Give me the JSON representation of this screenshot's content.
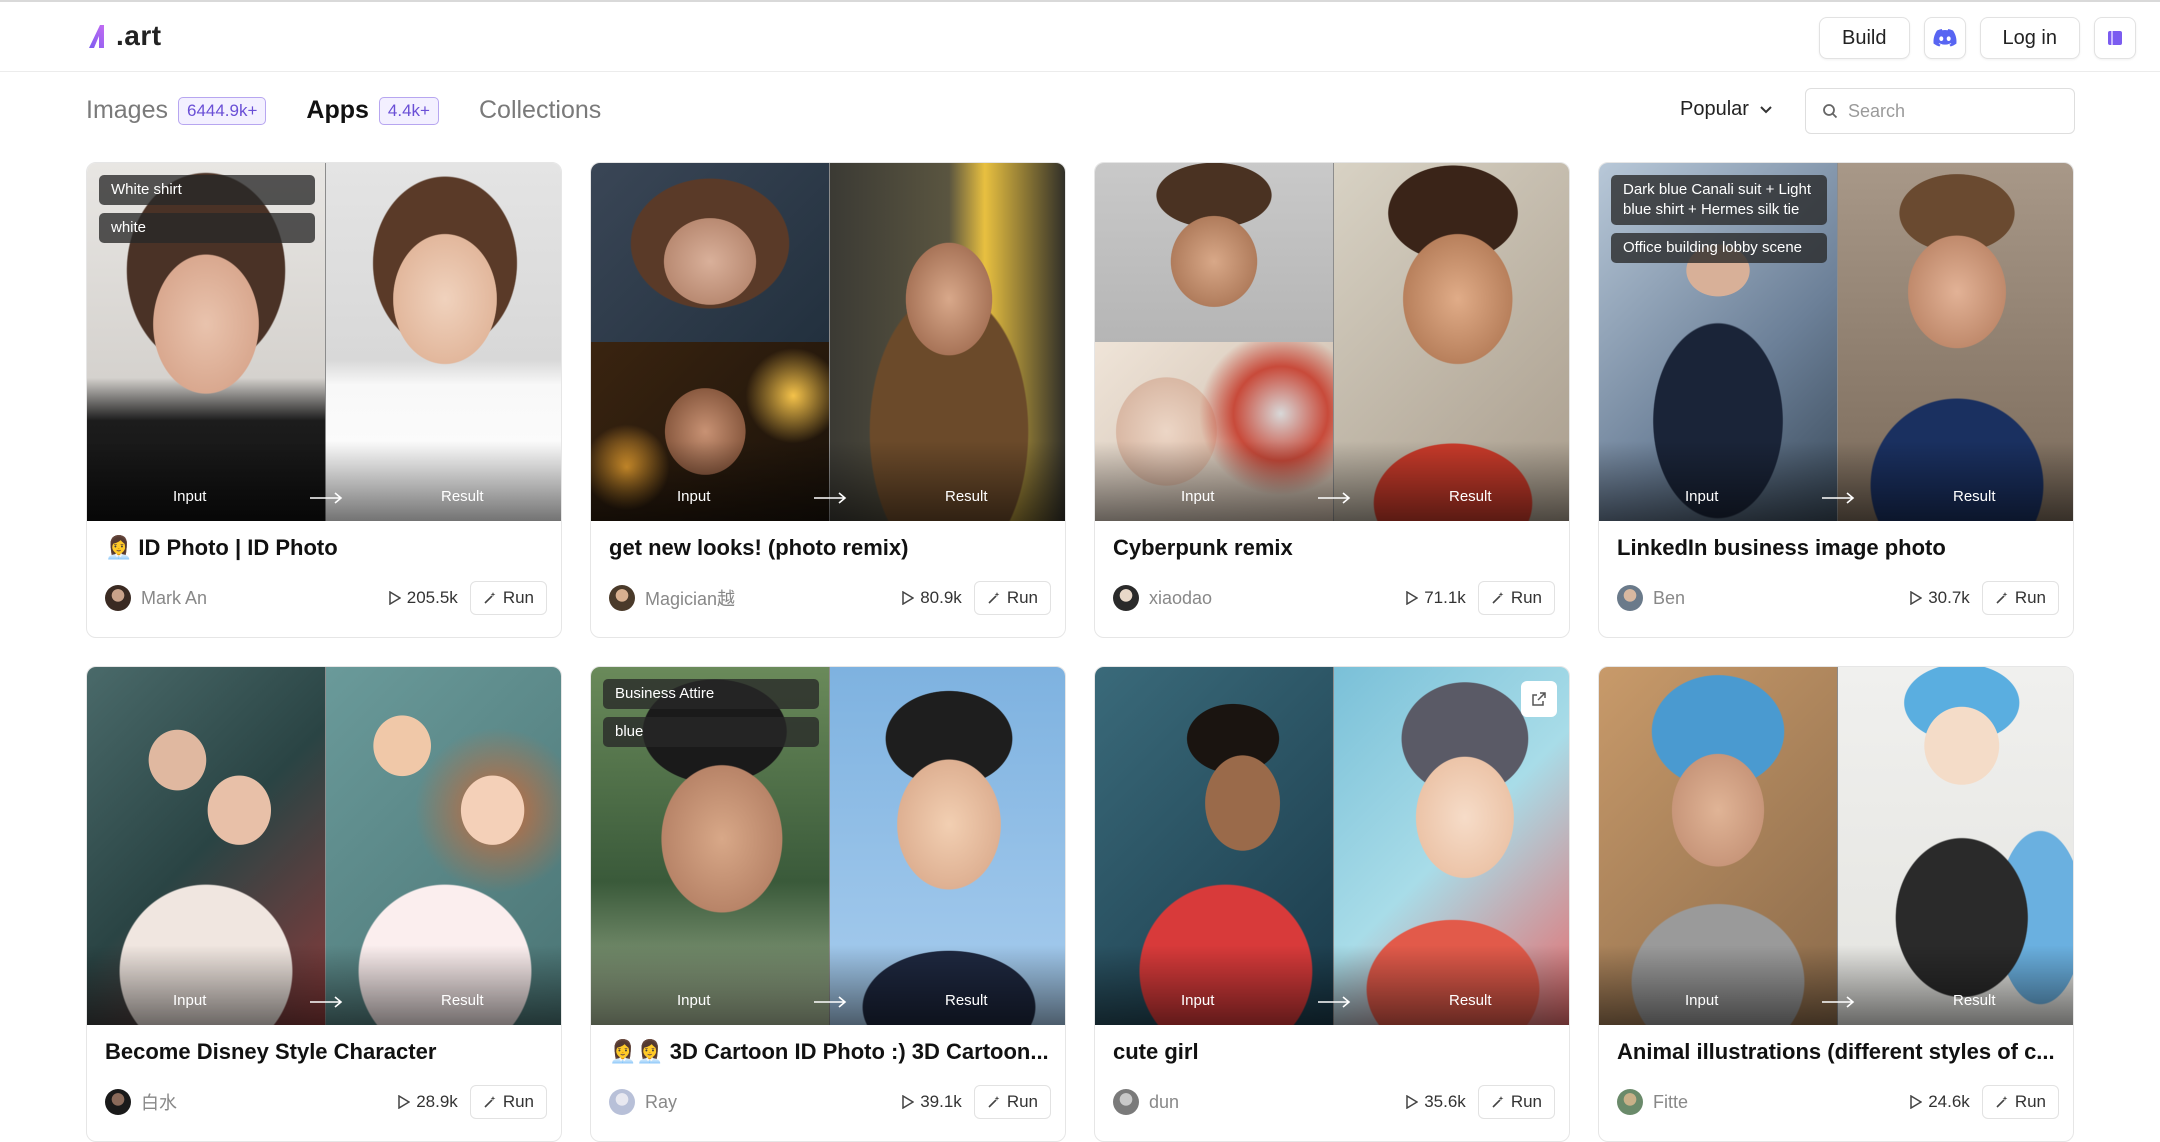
{
  "header": {
    "logo_text": ".art",
    "build_label": "Build",
    "discord_icon": "discord-icon",
    "login_label": "Log in",
    "menu_icon": "book-icon"
  },
  "nav": {
    "tabs": [
      {
        "label": "Images",
        "count": "6444.9k+"
      },
      {
        "label": "Apps",
        "count": "4.4k+"
      },
      {
        "label": "Collections",
        "count": ""
      }
    ],
    "sort_label": "Popular",
    "search_placeholder": "Search"
  },
  "labels": {
    "input": "Input",
    "result": "Result",
    "run": "Run"
  },
  "cards": [
    {
      "title": "ID Photo | ID Photo",
      "emoji": "👩‍💼",
      "author": "Mark An",
      "plays": "205.5k",
      "tags": [
        "White shirt",
        "white"
      ]
    },
    {
      "title": "get new looks!  (photo remix)",
      "emoji": "",
      "author": "Magician越",
      "plays": "80.9k",
      "tags": []
    },
    {
      "title": "Cyberpunk remix",
      "emoji": "",
      "author": "xiaodao",
      "plays": "71.1k",
      "tags": []
    },
    {
      "title": "LinkedIn business image photo",
      "emoji": "",
      "author": "Ben",
      "plays": "30.7k",
      "tags": [
        "Dark blue Canali suit + Light blue shirt + Hermes silk tie",
        "Office building lobby scene"
      ]
    },
    {
      "title": "Become Disney Style Character",
      "emoji": "",
      "author": "白水",
      "plays": "28.9k",
      "tags": []
    },
    {
      "title": "3D Cartoon ID Photo :) 3D Cartoon...",
      "emoji": "👩‍💼👩‍💼",
      "author": "Ray",
      "plays": "39.1k",
      "tags": [
        "Business Attire",
        "blue"
      ]
    },
    {
      "title": "cute girl",
      "emoji": "",
      "author": "dun",
      "plays": "35.6k",
      "tags": []
    },
    {
      "title": "Animal illustrations (different styles of c...",
      "emoji": "",
      "author": "Fitte",
      "plays": "24.6k",
      "tags": []
    }
  ],
  "colors": {
    "accent": "#6a4fd6",
    "discord": "#5865f2"
  }
}
